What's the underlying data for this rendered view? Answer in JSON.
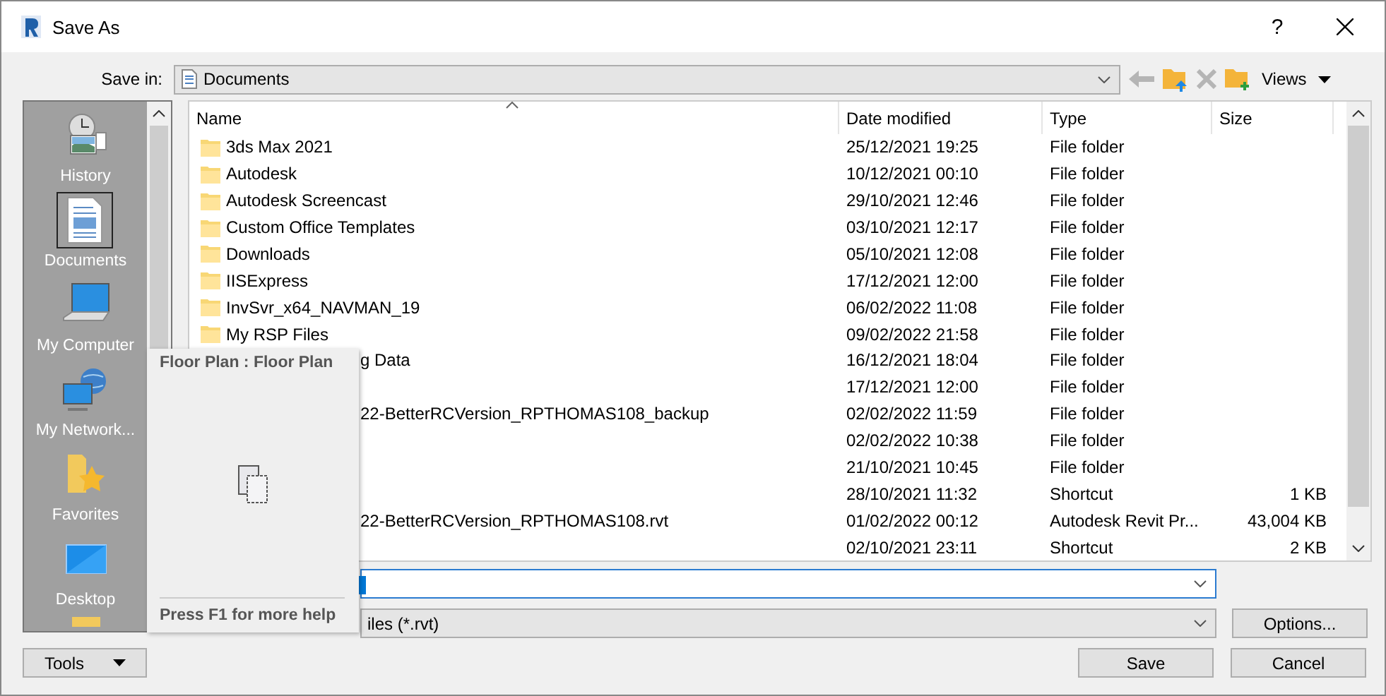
{
  "window": {
    "title": "Save As",
    "help": "?"
  },
  "toolbar": {
    "save_in_label": "Save in:",
    "location": "Documents",
    "views": "Views"
  },
  "places": [
    {
      "label": "History",
      "selected": false
    },
    {
      "label": "Documents",
      "selected": true
    },
    {
      "label": "My Computer",
      "selected": false
    },
    {
      "label": "My Network...",
      "selected": false
    },
    {
      "label": "Favorites",
      "selected": false
    },
    {
      "label": "Desktop",
      "selected": false
    }
  ],
  "table": {
    "columns": [
      "Name",
      "Date modified",
      "Type",
      "Size"
    ],
    "rows": [
      {
        "kind": "folder",
        "name": "3ds Max 2021",
        "date": "25/12/2021 19:25",
        "type": "File folder"
      },
      {
        "kind": "folder",
        "name": "Autodesk",
        "date": "10/12/2021 00:10",
        "type": "File folder"
      },
      {
        "kind": "folder",
        "name": "Autodesk Screencast",
        "date": "29/10/2021 12:46",
        "type": "File folder"
      },
      {
        "kind": "folder",
        "name": "Custom Office Templates",
        "date": "03/10/2021 12:17",
        "type": "File folder"
      },
      {
        "kind": "folder",
        "name": "Downloads",
        "date": "05/10/2021 12:08",
        "type": "File folder"
      },
      {
        "kind": "folder",
        "name": "IISExpress",
        "date": "17/12/2021 12:00",
        "type": "File folder"
      },
      {
        "kind": "folder",
        "name": "InvSvr_x64_NAVMAN_19",
        "date": "06/02/2022 11:08",
        "type": "File folder"
      },
      {
        "kind": "folder",
        "name": "My RSP Files",
        "date": "09/02/2022 21:58",
        "type": "File folder"
      },
      {
        "kind": "covered",
        "name": "g Data",
        "date": "16/12/2021 18:04",
        "type": "File folder"
      },
      {
        "kind": "covered",
        "date": "17/12/2021 12:00",
        "type": "File folder"
      },
      {
        "kind": "covered",
        "name": "22-BetterRCVersion_RPTHOMAS108_backup",
        "date": "02/02/2022 11:59",
        "type": "File folder"
      },
      {
        "kind": "covered",
        "date": "02/02/2022 10:38",
        "type": "File folder"
      },
      {
        "kind": "covered",
        "date": "21/10/2021 10:45",
        "type": "File folder"
      },
      {
        "kind": "covered",
        "date": "28/10/2021 11:32",
        "type": "Shortcut",
        "size": "1 KB"
      },
      {
        "kind": "covered",
        "name": "22-BetterRCVersion_RPTHOMAS108.rvt",
        "date": "01/02/2022 00:12",
        "type": "Autodesk Revit Pr...",
        "size": "43,004 KB"
      },
      {
        "kind": "covered",
        "date": "02/10/2021 23:11",
        "type": "Shortcut",
        "size": "2 KB"
      }
    ]
  },
  "file_type": "iles  (*.rvt)",
  "tooltip": {
    "title": "Floor Plan : Floor Plan",
    "help": "Press F1 for more help"
  },
  "buttons": {
    "tools": "Tools",
    "options": "Options...",
    "save": "Save",
    "cancel": "Cancel"
  }
}
